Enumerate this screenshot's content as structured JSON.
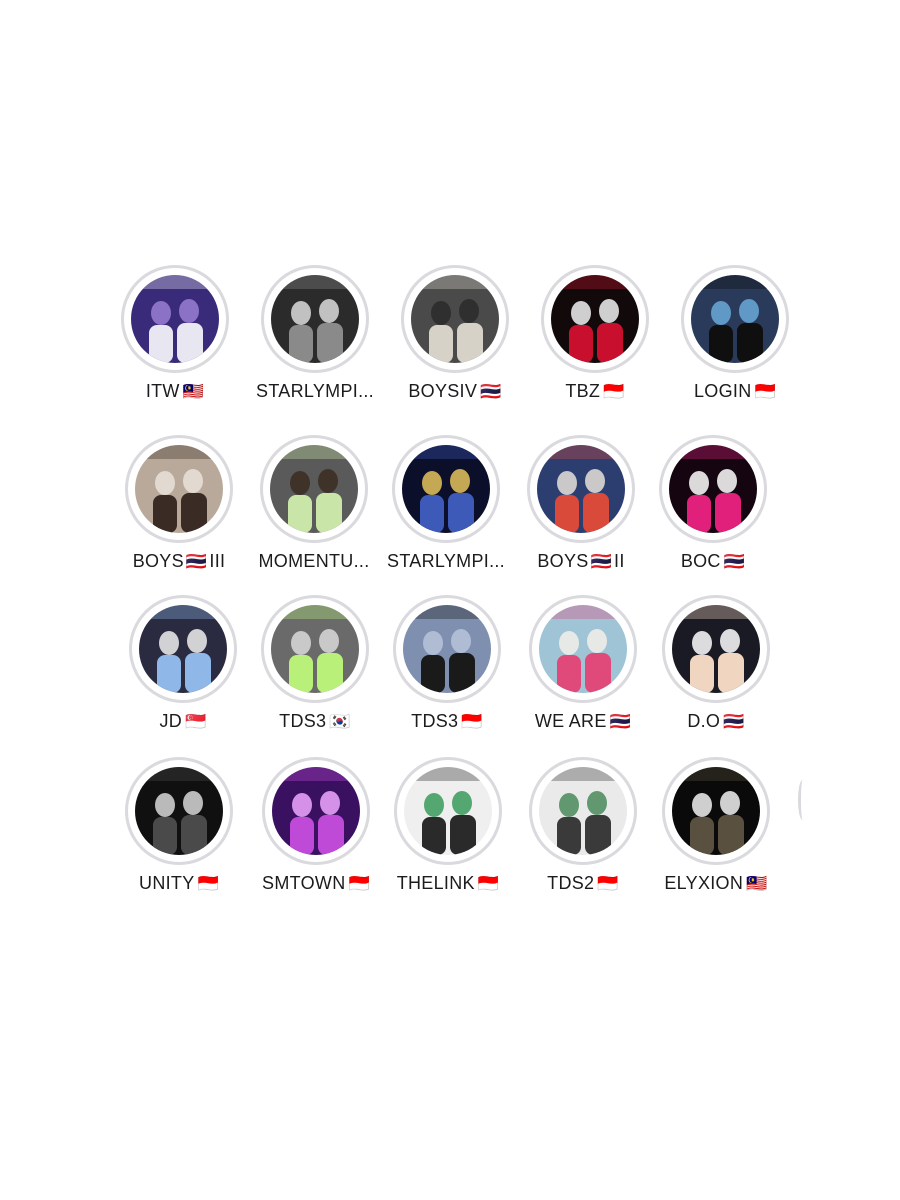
{
  "highlights": [
    {
      "name": "ITW",
      "flag": "🇲🇾",
      "colors": [
        "#3a2a7a",
        "#e8e6f0",
        "#9b7fd4"
      ]
    },
    {
      "name": "STARLYMPI...",
      "flag": "",
      "colors": [
        "#2b2b2b",
        "#8a8a8a",
        "#dcdcdc"
      ]
    },
    {
      "name": "BOYSIV",
      "flag": "🇹🇭",
      "colors": [
        "#4a4a4a",
        "#d7d2c8",
        "#2a2a2a"
      ]
    },
    {
      "name": "TBZ ",
      "flag": "🇮🇩",
      "colors": [
        "#120a0a",
        "#c8102e",
        "#f2f2f2"
      ]
    },
    {
      "name": "LOGIN",
      "flag": "🇮🇩",
      "colors": [
        "#2a3a5a",
        "#0f0f0f",
        "#6aa9d9"
      ]
    },
    {
      "name": "BOYS",
      "flag": "🇹🇭",
      "suffix": "III",
      "colors": [
        "#b9a99a",
        "#3a2c24",
        "#e9e2da"
      ]
    },
    {
      "name": "MOMENTU...",
      "flag": "",
      "colors": [
        "#5a5a5a",
        "#c9e6a8",
        "#3b2b20"
      ]
    },
    {
      "name": "STARLYMPI...",
      "flag": "",
      "colors": [
        "#0b0f2a",
        "#3d5ab8",
        "#e6c35a"
      ]
    },
    {
      "name": "BOYS",
      "flag": "🇹🇭",
      "suffix": "II",
      "colors": [
        "#2c3e70",
        "#d94a3a",
        "#e8e0d8"
      ]
    },
    {
      "name": "BOC",
      "flag": "🇹🇭",
      "colors": [
        "#150510",
        "#e0207a",
        "#ffffff"
      ]
    },
    {
      "name": "JD",
      "flag": "🇸🇬",
      "colors": [
        "#2a2a40",
        "#8fb7e8",
        "#f0f0f0"
      ]
    },
    {
      "name": "TDS3",
      "flag": "🇰🇷",
      "colors": [
        "#6a6a6a",
        "#b8f07a",
        "#d9d9d9"
      ]
    },
    {
      "name": "TDS3",
      "flag": "🇮🇩",
      "colors": [
        "#7e8fb0",
        "#1a1a1a",
        "#b9c4d9"
      ]
    },
    {
      "name": "WE ARE",
      "flag": "🇹🇭",
      "colors": [
        "#9fc4d6",
        "#e04a7a",
        "#f3f0ea"
      ]
    },
    {
      "name": "D.O",
      "flag": "🇹🇭",
      "colors": [
        "#1a1a24",
        "#f0d6c0",
        "#ffffff"
      ]
    },
    {
      "name": "UNITY",
      "flag": "🇮🇩",
      "colors": [
        "#101010",
        "#4a4a4a",
        "#d8d8d8"
      ]
    },
    {
      "name": "SMTOWN",
      "flag": "🇮🇩",
      "colors": [
        "#3a1060",
        "#c04ad8",
        "#f0a8ff"
      ]
    },
    {
      "name": "THELINK",
      "flag": "🇮🇩",
      "colors": [
        "#efefef",
        "#2a2a2a",
        "#3a9a5a"
      ]
    },
    {
      "name": "TDS2",
      "flag": "🇮🇩",
      "colors": [
        "#eaeaea",
        "#3a3a3a",
        "#4a8a5a"
      ]
    },
    {
      "name": "ELYXION",
      "flag": "🇲🇾",
      "colors": [
        "#0a0a0a",
        "#5a5040",
        "#f2f2f2"
      ]
    }
  ]
}
